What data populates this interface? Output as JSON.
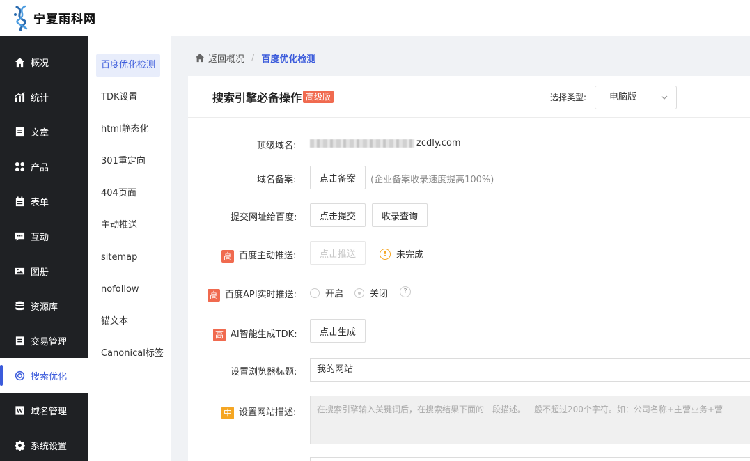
{
  "header": {
    "logo_icon": "dna-helix-logo",
    "logo_text": "宁夏雨科网"
  },
  "sidebar": {
    "items": [
      {
        "label": "概况",
        "icon": "home-icon"
      },
      {
        "label": "统计",
        "icon": "chart-icon"
      },
      {
        "label": "文章",
        "icon": "article-icon"
      },
      {
        "label": "产品",
        "icon": "grid-icon"
      },
      {
        "label": "表单",
        "icon": "calendar-icon"
      },
      {
        "label": "互动",
        "icon": "chat-icon"
      },
      {
        "label": "图册",
        "icon": "image-icon"
      },
      {
        "label": "资源库",
        "icon": "database-icon"
      },
      {
        "label": "交易管理",
        "icon": "order-icon"
      },
      {
        "label": "搜索优化",
        "icon": "target-icon"
      },
      {
        "label": "域名管理",
        "icon": "w-icon"
      },
      {
        "label": "系统设置",
        "icon": "gear-icon"
      }
    ],
    "active_index": 9,
    "accent_color": "#3b5bdb"
  },
  "subnav": {
    "items": [
      "百度优化检测",
      "TDK设置",
      "html静态化",
      "301重定向",
      "404页面",
      "主动推送",
      "sitemap",
      "nofollow",
      "锚文本",
      "Canonical标签"
    ],
    "active_index": 0
  },
  "breadcrumb": {
    "back": "返回概况",
    "separator": "/",
    "current": "百度优化检测"
  },
  "card": {
    "title": "搜索引擎必备操作",
    "badge": "高级版",
    "type_label": "选择类型:",
    "type_value": "电脑版"
  },
  "form": {
    "top_domain_label": "顶级域名:",
    "top_domain_value": "zcdly.com",
    "icp_label": "域名备案:",
    "icp_button": "点击备案",
    "icp_hint": "(企业备案收录速度提高100%)",
    "submit_label": "提交网址给百度:",
    "submit_button": "点击提交",
    "index_query_button": "收录查询",
    "push_tag": "高",
    "push_label": "百度主动推送:",
    "push_button": "点击推送",
    "push_status": "未完成",
    "api_tag": "高",
    "api_label": "百度API实时推送:",
    "api_on": "开启",
    "api_off": "关闭",
    "api_help": "?",
    "ai_tag": "高",
    "ai_label": "AI智能生成TDK:",
    "ai_button": "点击生成",
    "browser_title_label": "设置浏览器标题:",
    "browser_title_value": "我的网站",
    "desc_tag": "中",
    "desc_label": "设置网站描述:",
    "desc_placeholder": "在搜索引擎输入关键词后，在搜索结果下面的一段描述。一般不超过200个字符。如：公司名称+主营业务+营"
  },
  "colors": {
    "tag_high": "#f06a4f",
    "tag_mid": "#f5a623",
    "sidebar_bg": "#1f2124"
  }
}
